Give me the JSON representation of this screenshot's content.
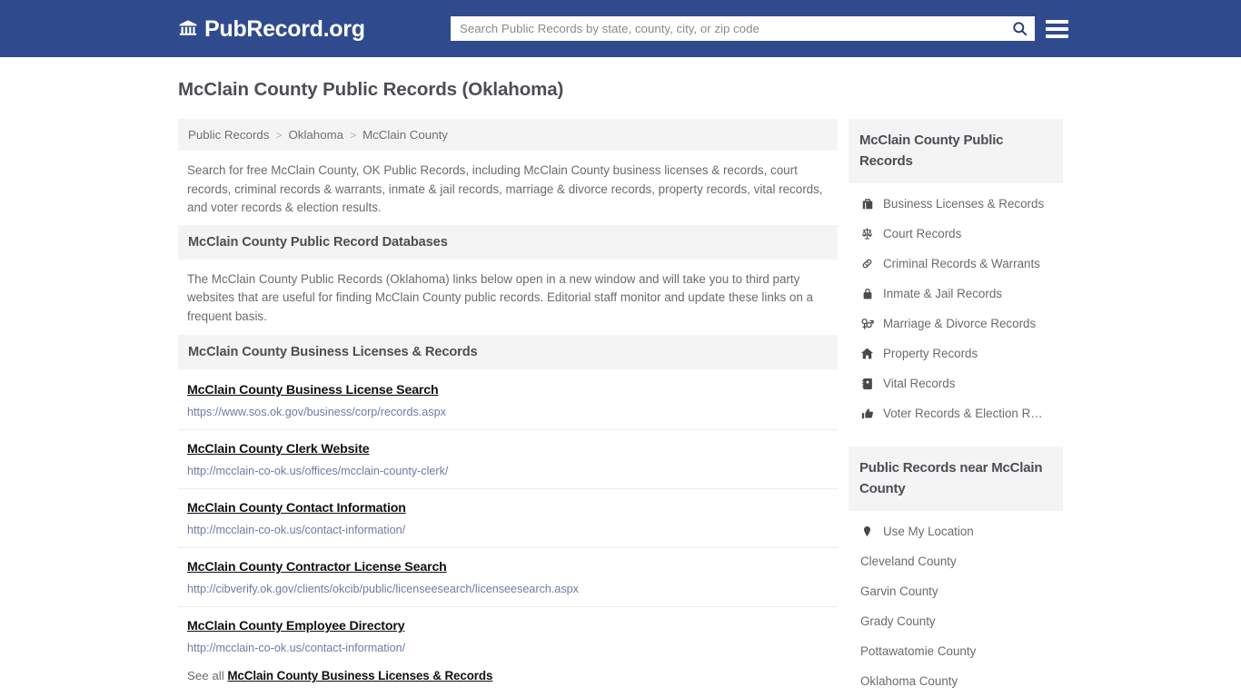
{
  "header": {
    "brand_name": "PubRecord.org",
    "brand_icon": "bank-icon",
    "search_placeholder": "Search Public Records by state, county, city, or zip code",
    "search_value": "",
    "search_icon": "search-icon",
    "menu_icon": "hamburger-menu-icon",
    "background_color": "#2f4b8e"
  },
  "page": {
    "title": "McClain County Public Records (Oklahoma)"
  },
  "breadcrumb": {
    "items": [
      {
        "label": "Public Records"
      },
      {
        "label": "Oklahoma"
      },
      {
        "label": "McClain County"
      }
    ],
    "separator": ">"
  },
  "intro": {
    "text": "Search for free McClain County, OK Public Records, including McClain County business licenses & records, court records, criminal records & warrants, inmate & jail records, marriage & divorce records, property records, vital records, and voter records & election results."
  },
  "databases_section": {
    "heading": "McClain County Public Record Databases",
    "body": "The McClain County Public Records (Oklahoma) links below open in a new window and will take you to third party websites that are useful for finding McClain County public records. Editorial staff monitor and update these links on a frequent basis."
  },
  "business_section": {
    "heading": "McClain County Business Licenses & Records",
    "links": [
      {
        "title": "McClain County Business License Search",
        "url": "https://www.sos.ok.gov/business/corp/records.aspx"
      },
      {
        "title": "McClain County Clerk Website",
        "url": "http://mcclain-co-ok.us/offices/mcclain-county-clerk/"
      },
      {
        "title": "McClain County Contact Information",
        "url": "http://mcclain-co-ok.us/contact-information/"
      },
      {
        "title": "McClain County Contractor License Search",
        "url": "http://cibverify.ok.gov/clients/okcib/public/licenseesearch/licenseesearch.aspx"
      },
      {
        "title": "McClain County Employee Directory",
        "url": "http://mcclain-co-ok.us/contact-information/"
      }
    ],
    "see_all_prefix": "See all",
    "see_all_link": "McClain County Business Licenses & Records"
  },
  "sidebar": {
    "records_panel": {
      "heading": "McClain County Public Records",
      "items": [
        {
          "label": "Business Licenses & Records",
          "icon": "briefcase-icon"
        },
        {
          "label": "Court Records",
          "icon": "scales-icon"
        },
        {
          "label": "Criminal Records & Warrants",
          "icon": "link-chain-icon"
        },
        {
          "label": "Inmate & Jail Records",
          "icon": "lock-icon"
        },
        {
          "label": "Marriage & Divorce Records",
          "icon": "gender-symbols-icon"
        },
        {
          "label": "Property Records",
          "icon": "home-icon"
        },
        {
          "label": "Vital Records",
          "icon": "id-card-icon"
        },
        {
          "label": "Voter Records & Election R…",
          "icon": "thumbs-up-icon"
        }
      ]
    },
    "nearby_panel": {
      "heading": "Public Records near McClain County",
      "items": [
        {
          "label": "Use My Location",
          "icon": "map-pin-icon"
        },
        {
          "label": "Cleveland County",
          "icon": ""
        },
        {
          "label": "Garvin County",
          "icon": ""
        },
        {
          "label": "Grady County",
          "icon": ""
        },
        {
          "label": "Pottawatomie County",
          "icon": ""
        },
        {
          "label": "Oklahoma County",
          "icon": ""
        }
      ]
    }
  }
}
